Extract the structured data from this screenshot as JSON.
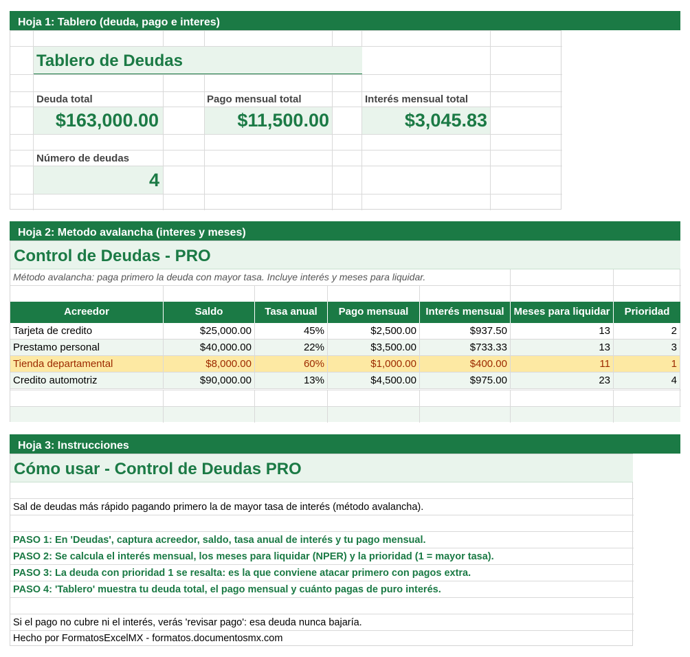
{
  "colors": {
    "accent": "#1b7a45",
    "highlight_bg": "#fde9a3",
    "highlight_text": "#9c2a00",
    "light_green": "#e9f4ec"
  },
  "sheet1": {
    "bar_title": "Hoja 1: Tablero (deuda, pago e interes)",
    "title": "Tablero de Deudas",
    "kpis": [
      {
        "label": "Deuda total",
        "value": "$163,000.00"
      },
      {
        "label": "Pago mensual total",
        "value": "$11,500.00"
      },
      {
        "label": "Interés mensual total",
        "value": "$3,045.83"
      },
      {
        "label": "Número de deudas",
        "value": "4"
      }
    ]
  },
  "sheet2": {
    "bar_title": "Hoja 2: Metodo avalancha (interes y meses)",
    "title": "Control de Deudas - PRO",
    "subtitle": "Método avalancha: paga primero la deuda con mayor tasa. Incluye interés y meses para liquidar.",
    "headers": [
      "Acreedor",
      "Saldo",
      "Tasa anual",
      "Pago mensual",
      "Interés mensual",
      "Meses para liquidar",
      "Prioridad"
    ],
    "rows": [
      [
        "Tarjeta de credito",
        "$25,000.00",
        "45%",
        "$2,500.00",
        "$937.50",
        "13",
        "2"
      ],
      [
        "Prestamo personal",
        "$40,000.00",
        "22%",
        "$3,500.00",
        "$733.33",
        "13",
        "3"
      ],
      [
        "Tienda departamental",
        "$8,000.00",
        "60%",
        "$1,000.00",
        "$400.00",
        "11",
        "1"
      ],
      [
        "Credito automotriz",
        "$90,000.00",
        "13%",
        "$4,500.00",
        "$975.00",
        "23",
        "4"
      ]
    ]
  },
  "sheet3": {
    "bar_title": "Hoja 3: Instrucciones",
    "title": "Cómo usar - Control de Deudas PRO",
    "intro": "Sal de deudas más rápido pagando primero la de mayor tasa de interés (método avalancha).",
    "steps": [
      "PASO 1: En 'Deudas', captura acreedor, saldo, tasa anual de interés y tu pago mensual.",
      "PASO 2: Se calcula el interés mensual, los meses para liquidar (NPER) y la prioridad (1 = mayor tasa).",
      "PASO 3: La deuda con prioridad 1 se resalta: es la que conviene atacar primero con pagos extra.",
      "PASO 4: 'Tablero' muestra tu deuda total, el pago mensual y cuánto pagas de puro interés."
    ],
    "note": "Si el pago no cubre ni el interés, verás 'revisar pago': esa deuda nunca bajaría.",
    "footer": "Hecho por FormatosExcelMX - formatos.documentosmx.com"
  }
}
